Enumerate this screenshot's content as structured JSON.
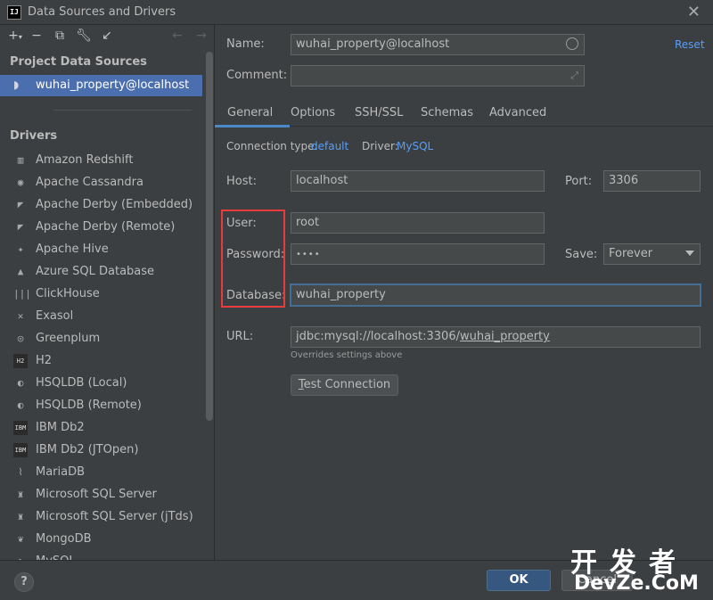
{
  "window": {
    "title": "Data Sources and Drivers",
    "app_icon_text": "IJ"
  },
  "left": {
    "project_section": "Project Data Sources",
    "selected_source": "wuhai_property@localhost",
    "drivers_section": "Drivers",
    "drivers": [
      {
        "label": "Amazon Redshift",
        "icon": "redshift-icon",
        "glyph": "▥"
      },
      {
        "label": "Apache Cassandra",
        "icon": "cassandra-icon",
        "glyph": "◉"
      },
      {
        "label": "Apache Derby (Embedded)",
        "icon": "derby-icon",
        "glyph": "◤"
      },
      {
        "label": "Apache Derby (Remote)",
        "icon": "derby-icon",
        "glyph": "◤"
      },
      {
        "label": "Apache Hive",
        "icon": "hive-icon",
        "glyph": "✦"
      },
      {
        "label": "Azure SQL Database",
        "icon": "azure-icon",
        "glyph": "▲"
      },
      {
        "label": "ClickHouse",
        "icon": "clickhouse-icon",
        "glyph": "|||"
      },
      {
        "label": "Exasol",
        "icon": "exasol-icon",
        "glyph": "✕"
      },
      {
        "label": "Greenplum",
        "icon": "greenplum-icon",
        "glyph": "◎"
      },
      {
        "label": "H2",
        "icon": "h2-icon",
        "glyph": "H2"
      },
      {
        "label": "HSQLDB (Local)",
        "icon": "hsqldb-icon",
        "glyph": "◐"
      },
      {
        "label": "HSQLDB (Remote)",
        "icon": "hsqldb-icon",
        "glyph": "◐"
      },
      {
        "label": "IBM Db2",
        "icon": "ibm-db2-icon",
        "glyph": "IBM"
      },
      {
        "label": "IBM Db2 (JTOpen)",
        "icon": "ibm-db2-icon",
        "glyph": "IBM"
      },
      {
        "label": "MariaDB",
        "icon": "mariadb-icon",
        "glyph": "⌇"
      },
      {
        "label": "Microsoft SQL Server",
        "icon": "mssql-icon",
        "glyph": "♜"
      },
      {
        "label": "Microsoft SQL Server (jTds)",
        "icon": "mssql-icon",
        "glyph": "♜"
      },
      {
        "label": "MongoDB",
        "icon": "mongodb-icon",
        "glyph": "❦"
      },
      {
        "label": "MySQL",
        "icon": "mysql-icon",
        "glyph": "◗"
      }
    ]
  },
  "form": {
    "name_label": "Name:",
    "name_value": "wuhai_property@localhost",
    "reset": "Reset",
    "comment_label": "Comment:",
    "comment_value": "",
    "tabs": [
      "General",
      "Options",
      "SSH/SSL",
      "Schemas",
      "Advanced"
    ],
    "connection_type_label": "Connection type:",
    "connection_type_value": "default",
    "driver_label": "Driver:",
    "driver_value": "MySQL",
    "host_label": "Host:",
    "host_value": "localhost",
    "port_label": "Port:",
    "port_value": "3306",
    "user_label": "User:",
    "user_value": "root",
    "password_label": "Password:",
    "password_value": "••••",
    "save_label": "Save:",
    "save_value": "Forever",
    "database_label": "Database:",
    "database_value": "wuhai_property",
    "url_label": "URL:",
    "url_prefix": "jdbc:mysql://localhost:3306/",
    "url_db": "wuhai_property",
    "url_hint": "Overrides settings above",
    "test_connection_first": "T",
    "test_connection_rest": "est Connection"
  },
  "footer": {
    "help": "?",
    "ok": "OK",
    "cancel": "Cancel"
  },
  "watermark": {
    "cn": "开发者",
    "en": "DevZe.CoM"
  }
}
